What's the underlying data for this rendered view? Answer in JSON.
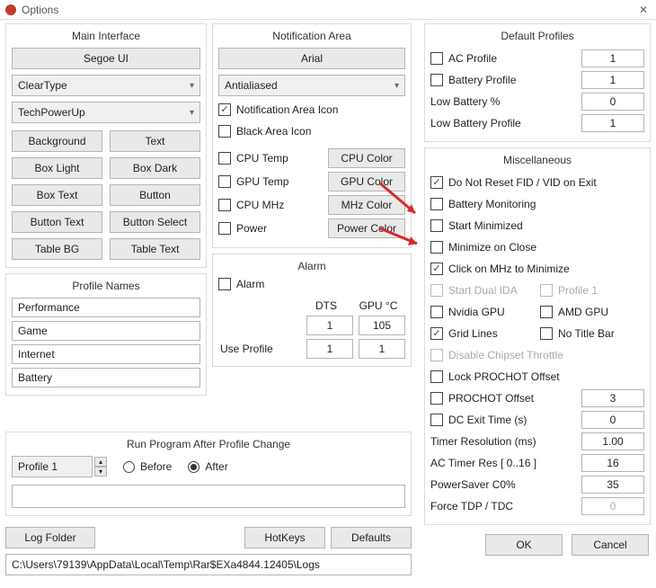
{
  "window": {
    "title": "Options",
    "close_glyph": "✕"
  },
  "main_interface": {
    "title": "Main Interface",
    "font_button": "Segoe UI",
    "rendering": "ClearType",
    "branding": "TechPowerUp",
    "buttons": {
      "background": "Background",
      "text": "Text",
      "box_light": "Box Light",
      "box_dark": "Box Dark",
      "box_text": "Box Text",
      "button": "Button",
      "button_text": "Button Text",
      "button_select": "Button Select",
      "table_bg": "Table BG",
      "table_text": "Table Text"
    }
  },
  "profile_names": {
    "title": "Profile Names",
    "items": [
      "Performance",
      "Game",
      "Internet",
      "Battery"
    ]
  },
  "notification": {
    "title": "Notification Area",
    "font_button": "Arial",
    "aa": "Antialiased",
    "cks": {
      "area_icon": "Notification Area Icon",
      "area_icon_checked": true,
      "black_icon": "Black Area Icon",
      "black_icon_checked": false,
      "cpu_temp": "CPU Temp",
      "cpu_temp_checked": false,
      "cpu_color": "CPU Color",
      "gpu_temp": "GPU Temp",
      "gpu_temp_checked": false,
      "gpu_color": "GPU Color",
      "cpu_mhz": "CPU MHz",
      "cpu_mhz_checked": false,
      "mhz_color": "MHz Color",
      "power": "Power",
      "power_checked": false,
      "power_color": "Power Color"
    }
  },
  "alarm": {
    "title": "Alarm",
    "enable": "Alarm",
    "enable_checked": false,
    "dts_label": "DTS",
    "gpu_label": "GPU °C",
    "dts": "1",
    "gpu": "105",
    "use_profile_label": "Use Profile",
    "use_profile_dts": "1",
    "use_profile_gpu": "1"
  },
  "defaults": {
    "title": "Default Profiles",
    "ac_profile": "AC Profile",
    "ac_profile_checked": false,
    "ac_profile_val": "1",
    "battery_profile": "Battery Profile",
    "battery_profile_checked": false,
    "battery_profile_val": "1",
    "low_batt_pct": "Low Battery %",
    "low_batt_pct_val": "0",
    "low_batt_profile": "Low Battery Profile",
    "low_batt_profile_val": "1"
  },
  "misc": {
    "title": "Miscellaneous",
    "no_reset": "Do Not Reset FID / VID on Exit",
    "no_reset_checked": true,
    "batt_mon": "Battery Monitoring",
    "batt_mon_checked": false,
    "start_min": "Start Minimized",
    "start_min_checked": false,
    "min_close": "Minimize on Close",
    "min_close_checked": false,
    "click_mhz": "Click on MHz to Minimize",
    "click_mhz_checked": true,
    "dual_ida": "Start Dual IDA",
    "dual_ida_checked": false,
    "profile1": "Profile 1",
    "profile1_checked": false,
    "nvidia": "Nvidia GPU",
    "nvidia_checked": false,
    "amd": "AMD GPU",
    "amd_checked": false,
    "grid": "Grid Lines",
    "grid_checked": true,
    "notitle": "No Title Bar",
    "notitle_checked": false,
    "discthr": "Disable Chipset Throttle",
    "discthr_checked": false,
    "lockpro": "Lock PROCHOT Offset",
    "lockpro_checked": false,
    "prooff": "PROCHOT Offset",
    "prooff_checked": false,
    "prooff_val": "3",
    "dcexit": "DC Exit Time (s)",
    "dcexit_checked": false,
    "dcexit_val": "0",
    "timer": "Timer Resolution (ms)",
    "timer_val": "1.00",
    "actimer": "AC Timer Res [ 0..16 ]",
    "actimer_val": "16",
    "ps": "PowerSaver C0%",
    "ps_val": "35",
    "force": "Force TDP / TDC",
    "force_val": "0"
  },
  "run": {
    "title": "Run Program After Profile Change",
    "profile": "Profile 1",
    "before": "Before",
    "after": "After",
    "selected": "after",
    "cmdline": ""
  },
  "bottom": {
    "log_folder": "Log Folder",
    "hotkeys": "HotKeys",
    "defaults": "Defaults",
    "path": "C:\\Users\\79139\\AppData\\Local\\Temp\\Rar$EXa4844.12405\\Logs"
  },
  "footer": {
    "ok": "OK",
    "cancel": "Cancel"
  }
}
